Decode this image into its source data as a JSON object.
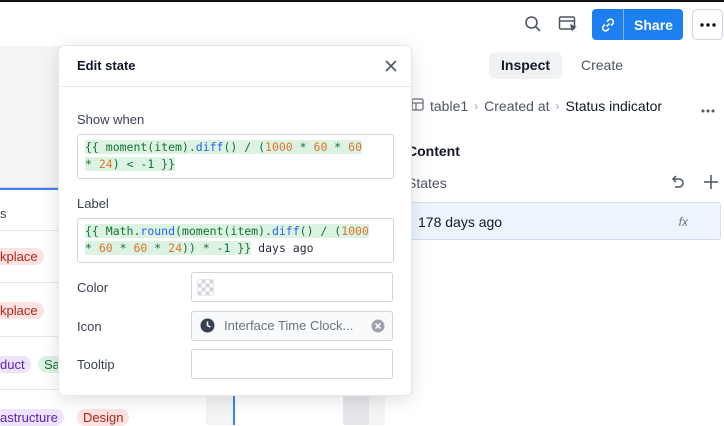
{
  "header": {
    "share_label": "Share",
    "icons": [
      "search-icon",
      "preview-icon",
      "link-icon",
      "more-icon"
    ],
    "accent": "#1d7ff0"
  },
  "canvas": {
    "column_header": "s",
    "tags": [
      {
        "text": "kplace",
        "color": "#fde2e2"
      },
      {
        "text": "kplace",
        "color": "#fde2e2"
      },
      {
        "text": "duct",
        "color": "#ede4fb"
      },
      {
        "text": "Sa",
        "color": "#dcf2e3"
      },
      {
        "text": "astructure",
        "color": "#ede4fb"
      },
      {
        "text": "Design",
        "color": "#fde2e2"
      }
    ]
  },
  "panel": {
    "tabs": [
      {
        "label": "Inspect",
        "active": true
      },
      {
        "label": "Create",
        "active": false
      }
    ],
    "breadcrumb": [
      "table1",
      "Created at",
      "Status indicator"
    ],
    "section_title": "Content",
    "states_label": "States",
    "state_item": {
      "label": "178 days ago",
      "badge": "fx"
    }
  },
  "modal": {
    "title": "Edit state",
    "show_when": {
      "label": "Show when",
      "line1_a": "{{ moment(item).",
      "line1_fn": "diff",
      "line1_b": "() / (",
      "line1_num1": "1000",
      "line1_c": " * ",
      "line1_num2": "60",
      "line1_d": " * ",
      "line1_num3": "60",
      "line2_a": "* ",
      "line2_num": "24",
      "line2_b": ") < -1 }}"
    },
    "label_field": {
      "label": "Label",
      "line1_a": "{{ Math.",
      "line1_fn1": "round",
      "line1_b": "(moment(item).",
      "line1_fn2": "diff",
      "line1_c": "() / (",
      "line1_num": "1000",
      "line2_a": "* ",
      "line2_num1": "60",
      "line2_b": " * ",
      "line2_num2": "60",
      "line2_c": " * ",
      "line2_num3": "24",
      "line2_d": ")) * -1 }}",
      "line2_plain": " days ago"
    },
    "color": {
      "label": "Color",
      "value": ""
    },
    "icon": {
      "label": "Icon",
      "value": "Interface Time Clock..."
    },
    "tooltip": {
      "label": "Tooltip",
      "value": ""
    }
  }
}
